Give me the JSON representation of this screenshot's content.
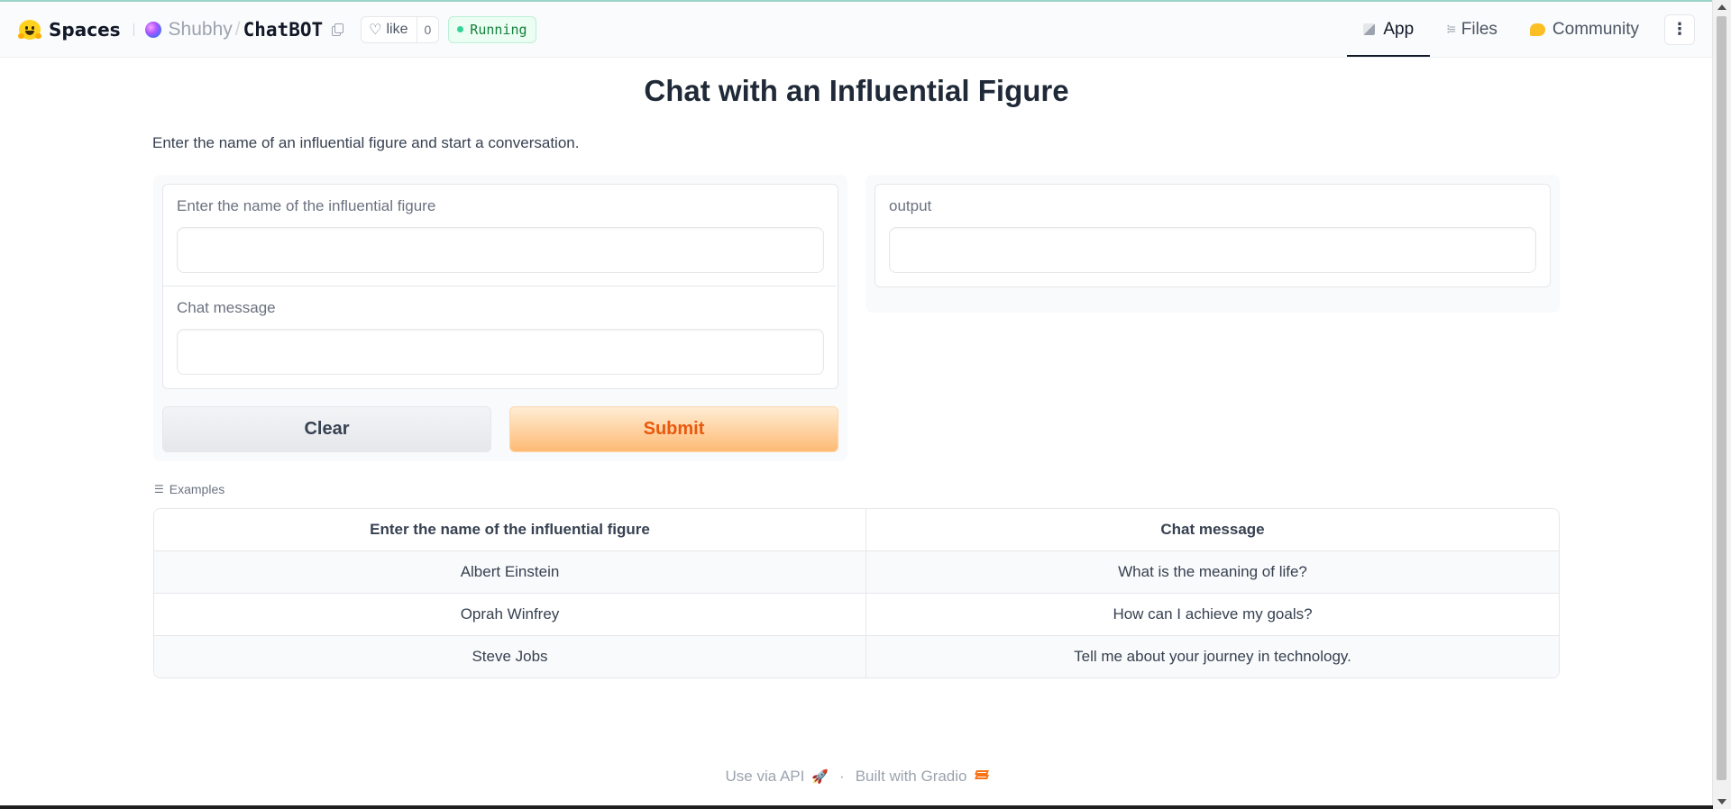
{
  "header": {
    "brand": "Spaces",
    "owner": "Shubhy",
    "separator": "/",
    "repo": "ChatBOT",
    "like_label": "like",
    "like_count": "0",
    "status": "Running",
    "tabs": [
      {
        "label": "App",
        "icon": "app-cube-icon",
        "active": true
      },
      {
        "label": "Files",
        "icon": "files-icon",
        "active": false
      },
      {
        "label": "Community",
        "icon": "community-icon",
        "active": false
      }
    ],
    "more_icon": "⋮"
  },
  "main": {
    "title": "Chat with an Influential Figure",
    "description": "Enter the name of an influential figure and start a conversation.",
    "inputs": {
      "figure_label": "Enter the name of the influential figure",
      "figure_value": "",
      "message_label": "Chat message",
      "message_value": ""
    },
    "output": {
      "label": "output",
      "value": ""
    },
    "buttons": {
      "clear": "Clear",
      "submit": "Submit"
    },
    "examples": {
      "heading": "Examples",
      "columns": [
        "Enter the name of the influential figure",
        "Chat message"
      ],
      "rows": [
        [
          "Albert Einstein",
          "What is the meaning of life?"
        ],
        [
          "Oprah Winfrey",
          "How can I achieve my goals?"
        ],
        [
          "Steve Jobs",
          "Tell me about your journey in technology."
        ]
      ]
    }
  },
  "footer": {
    "api_label": "Use via API",
    "dot": "·",
    "built_label": "Built with Gradio"
  },
  "colors": {
    "accent": "#ea580c",
    "status_green": "#15803d",
    "submit_gradient_end": "#fdba74"
  }
}
